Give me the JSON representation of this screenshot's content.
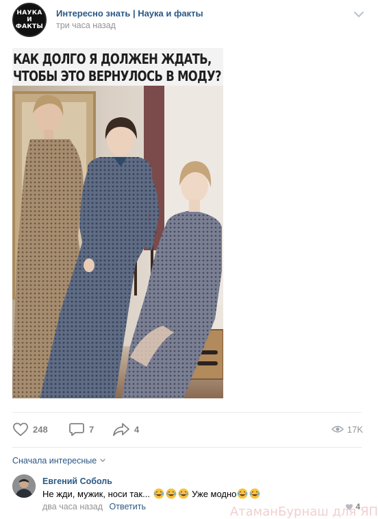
{
  "post": {
    "group_name": "Интересно знать | Наука и факты",
    "time": "три часа назад",
    "avatar_lines": [
      "НАУКА",
      "И",
      "ФАКТЫ"
    ],
    "menu_icon": "chevron-down-icon"
  },
  "image": {
    "caption_line1": "КАК ДОЛГО Я ДОЛЖЕН ЖДАТЬ,",
    "caption_line2": "ЧТОБЫ ЭТО ВЕРНУЛОСЬ В МОДУ?"
  },
  "actions": {
    "likes": "248",
    "comments": "7",
    "shares": "4",
    "views": "17K"
  },
  "comments_section": {
    "sort_label": "Сначала интересные"
  },
  "comment": {
    "author": "Евгений Соболь",
    "text_part1": "Не жди, мужик, носи так... ",
    "text_part2": " Уже модно",
    "emoji": "😂",
    "time": "два часа назад",
    "reply_label": "Ответить",
    "likes": "4"
  },
  "watermark": "АтаманБурнаш для ЯП",
  "colors": {
    "link": "#2a5885",
    "muted": "#939393",
    "icon": "#828282",
    "divider": "#e7e8ec"
  }
}
